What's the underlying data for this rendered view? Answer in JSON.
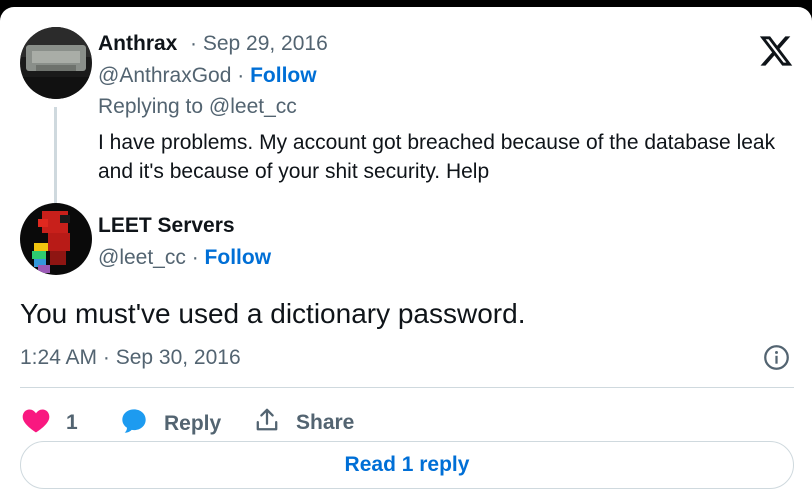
{
  "reply_to_tweet": {
    "author_name": "Anthrax",
    "date": "· Sep 29, 2016",
    "handle": "@AnthraxGod",
    "separator": "·",
    "follow_label": "Follow",
    "replying_prefix": "Replying to",
    "replying_handle": "@leet_cc",
    "text": "I have problems. My account got breached because of the database leak and it's because of your shit security. Help"
  },
  "main_tweet": {
    "author_name": "LEET Servers",
    "handle": "@leet_cc",
    "separator": "·",
    "follow_label": "Follow",
    "text": "You must've used a dictionary password.",
    "timestamp": "1:24 AM · Sep 30, 2016"
  },
  "actions": {
    "like_count": "1",
    "reply_label": "Reply",
    "share_label": "Share"
  },
  "read_replies_label": "Read 1 reply",
  "icons": [
    "x-logo-icon",
    "info-icon",
    "heart-icon",
    "reply-bubble-icon",
    "share-icon"
  ],
  "colors": {
    "link": "#006fd6",
    "secondary_text": "#536471",
    "like": "#f91880",
    "reply_bubble": "#1d9bf0",
    "border": "#cfd9de"
  }
}
